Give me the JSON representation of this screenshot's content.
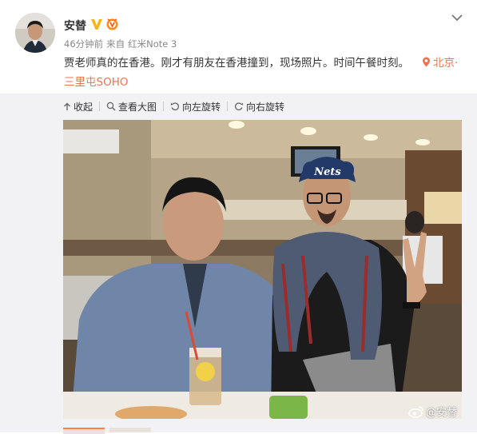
{
  "post": {
    "username": "安替",
    "time": "46分钟前",
    "source_prefix": "来自",
    "device": "红米Note 3",
    "text": "贾老师真的在香港。刚才有朋友在香港撞到，现场照片。时间午餐时刻。",
    "location": "北京·三里屯SOHO"
  },
  "toolbar": {
    "collapse": "收起",
    "view_large": "查看大图",
    "rotate_left": "向左旋转",
    "rotate_right": "向右旋转"
  },
  "photo": {
    "cap_text": "Nets",
    "watermark": "@安替"
  },
  "icons": {
    "verified": "verified-v-icon",
    "member": "member-badge-icon",
    "location": "location-pin-icon",
    "collapse": "arrow-up-icon",
    "zoom": "magnifier-icon",
    "rotate_left": "rotate-left-icon",
    "rotate_right": "rotate-right-icon",
    "menu": "chevron-down-icon",
    "weibo": "weibo-logo-icon"
  },
  "colors": {
    "link": "#eb7350",
    "verified": "#f8b51a",
    "panel": "#f2f2f5",
    "thumb_active": "#ff8140"
  }
}
